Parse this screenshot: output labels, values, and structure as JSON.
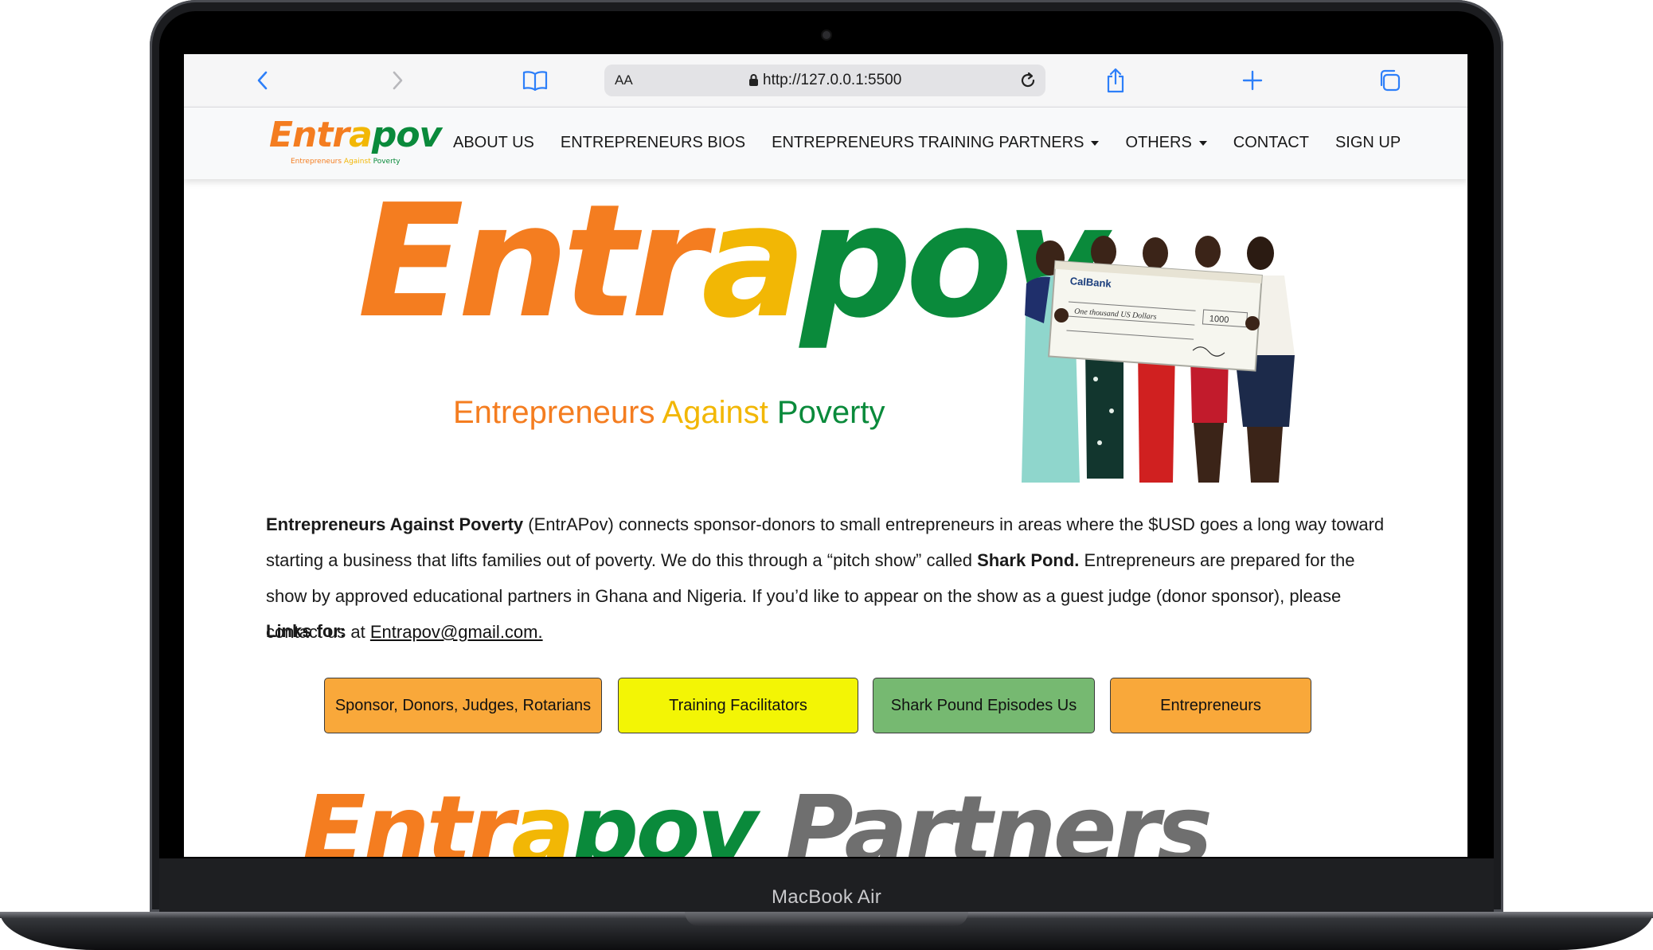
{
  "browser": {
    "aa_label": "AA",
    "url": "http://127.0.0.1:5500",
    "icons": [
      "back-icon",
      "forward-icon",
      "bookmarks-icon",
      "lock-icon",
      "reload-icon",
      "share-icon",
      "new-tab-icon",
      "tabs-icon"
    ]
  },
  "site": {
    "logo_parts": [
      "Entr",
      "a",
      "pov"
    ],
    "logo_tag_parts": [
      "Entrepreneurs ",
      "Against ",
      "Poverty"
    ],
    "nav": [
      {
        "label": "ABOUT US",
        "dropdown": false
      },
      {
        "label": "ENTREPRENEURS BIOS",
        "dropdown": false
      },
      {
        "label": "ENTREPRENEURS TRAINING PARTNERS",
        "dropdown": true
      },
      {
        "label": "OTHERS",
        "dropdown": true
      },
      {
        "label": "CONTACT",
        "dropdown": false
      },
      {
        "label": "SIGN UP",
        "dropdown": false
      }
    ]
  },
  "hero": {
    "logo_parts": [
      "Entr",
      "a",
      "pov"
    ],
    "tagline_parts": [
      "Entrepreneurs ",
      "Against ",
      "Poverty"
    ],
    "photo_text": {
      "bank": "CalBank",
      "amount": "1000",
      "words": "One thousand US Dollars"
    }
  },
  "intro": {
    "p1_bold": "Entrepreneurs Against Poverty",
    "p1_text": " (EntrAPov) connects sponsor-donors to small entrepreneurs in areas where the $USD goes a long way toward starting a business that lifts families out of poverty. We do this through a “pitch show” called ",
    "p1_bold2": "Shark Pond.",
    "p1_text2": " Entrepreneurs are prepared for the show by approved educational partners in Ghana and Nigeria. If you’d like to appear on the show as a guest judge (donor sponsor), please contact us at ",
    "email": "Entrapov@gmail.com."
  },
  "links_for": "Links for:",
  "buttons": [
    {
      "label": "Sponsor, Donors, Judges, Rotarians",
      "color": "#f9a83a"
    },
    {
      "label": "Training Facilitators",
      "color": "#f3f505"
    },
    {
      "label": "Shark Pound Episodes Us",
      "color": "#76b971"
    },
    {
      "label": "Entrepreneurs",
      "color": "#f9a83a"
    }
  ],
  "partners_heading_parts": [
    "Entr",
    "a",
    "pov",
    "Partners"
  ],
  "device_label": "MacBook Air",
  "colors": {
    "orange": "#f47d20",
    "yellow": "#f2b705",
    "green": "#0a8a3b",
    "safari_blue": "#2d7ff9"
  }
}
